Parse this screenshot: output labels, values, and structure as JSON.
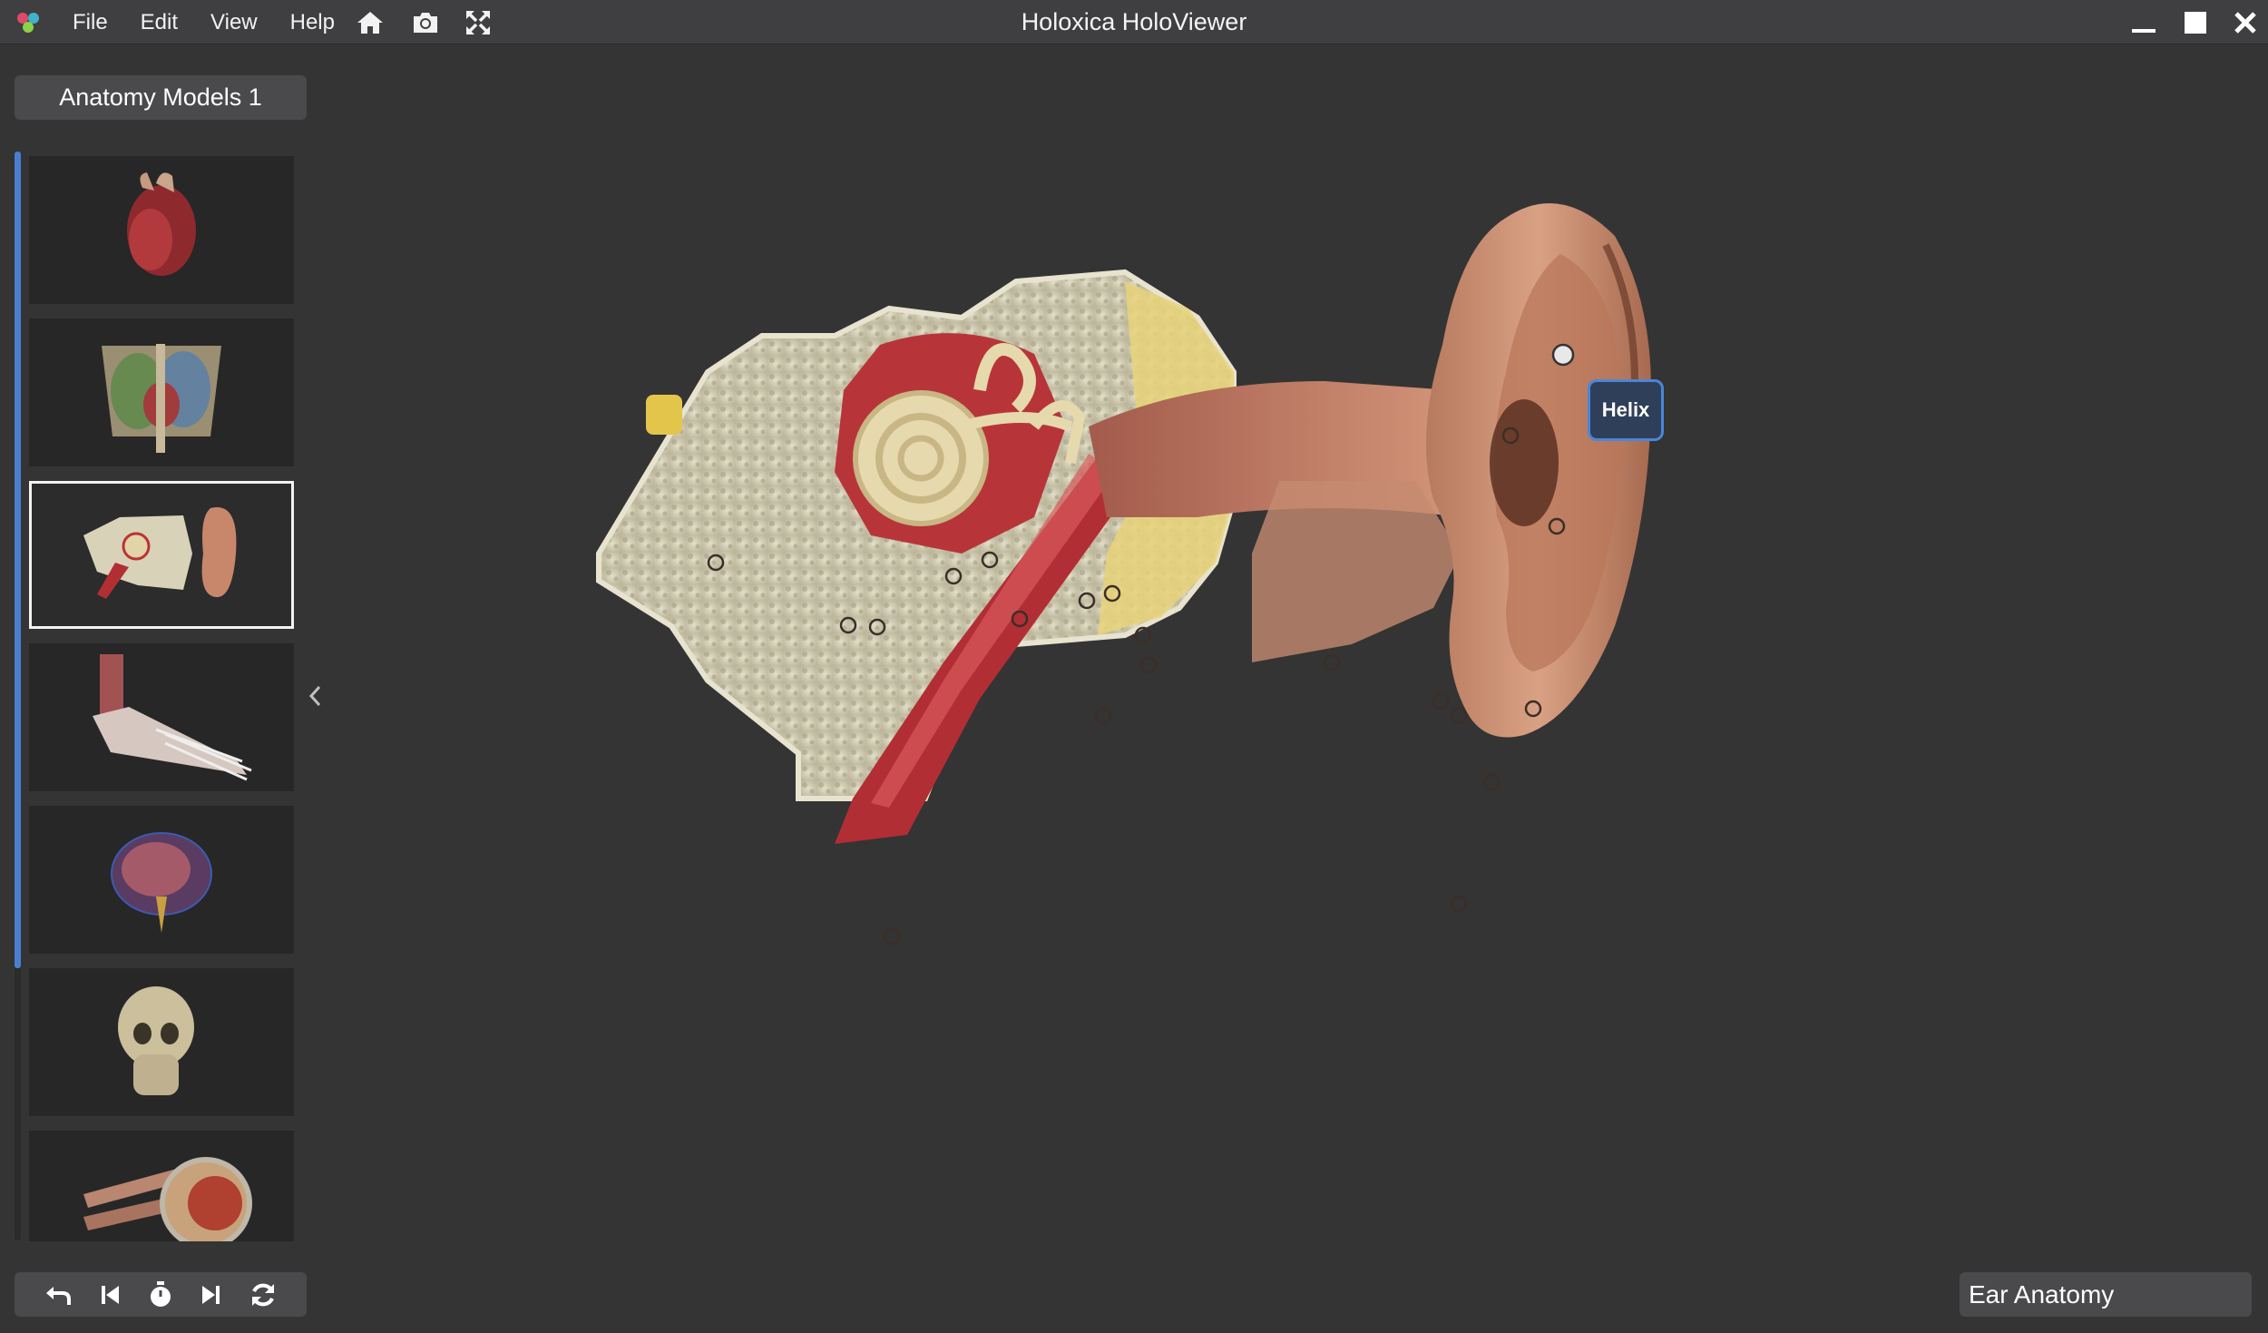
{
  "app": {
    "title": "Holoxica HoloViewer",
    "logo_icon": "holoxica-logo-icon"
  },
  "menu": [
    "File",
    "Edit",
    "View",
    "Help"
  ],
  "toolbar_icons": [
    "home-icon",
    "camera-icon",
    "fullscreen-icon"
  ],
  "window_controls": [
    "minimize-icon",
    "maximize-icon",
    "close-icon"
  ],
  "sidebar": {
    "collection_title": "Anatomy Models 1",
    "thumbnails": [
      {
        "subject": "heart",
        "selected": false
      },
      {
        "subject": "thorax",
        "selected": false
      },
      {
        "subject": "ear",
        "selected": true
      },
      {
        "subject": "foot",
        "selected": false
      },
      {
        "subject": "brain",
        "selected": false
      },
      {
        "subject": "skull",
        "selected": false
      },
      {
        "subject": "eye",
        "selected": false
      }
    ],
    "collapse_icon": "chevron-left-icon"
  },
  "playback_controls": [
    "undo-icon",
    "skip-previous-icon",
    "timer-icon",
    "skip-next-icon",
    "refresh-icon"
  ],
  "viewer": {
    "active_label": "Helix",
    "model_name": "Ear Anatomy"
  },
  "colors": {
    "accent": "#4a86d8",
    "background": "#343434",
    "titlebar": "#3f3f41",
    "panel": "#4a4a4c"
  }
}
